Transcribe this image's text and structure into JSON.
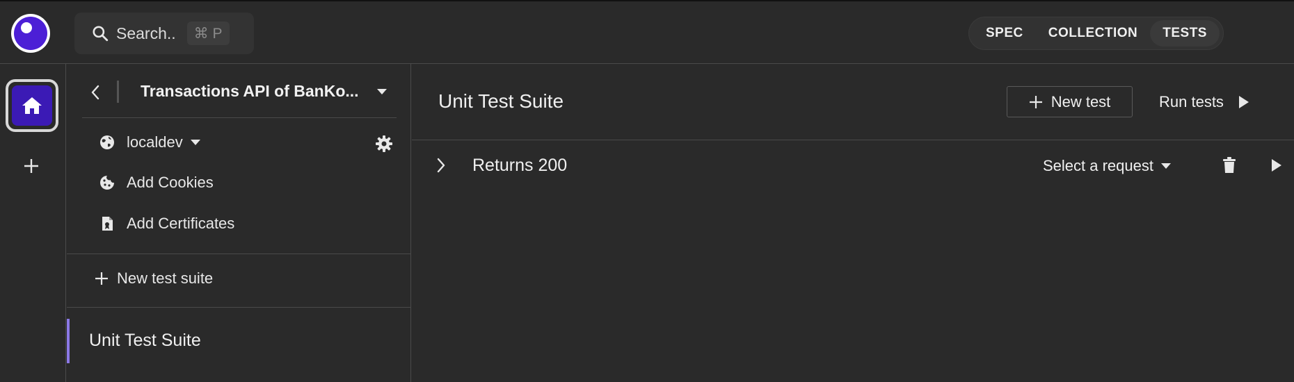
{
  "topbar": {
    "search_placeholder": "Search..",
    "search_shortcut": "⌘ P",
    "tabs": [
      {
        "label": "SPEC",
        "active": false
      },
      {
        "label": "COLLECTION",
        "active": false
      },
      {
        "label": "TESTS",
        "active": true
      }
    ]
  },
  "sidebar": {
    "project_title": "Transactions API of BanKo...",
    "environment": "localdev",
    "add_cookies": "Add Cookies",
    "add_certificates": "Add Certificates",
    "new_test_suite": "New test suite",
    "suites": [
      {
        "label": "Unit Test Suite",
        "selected": true
      }
    ]
  },
  "main": {
    "title": "Unit Test Suite",
    "new_test_label": "New test",
    "run_tests_label": "Run tests",
    "tests": [
      {
        "name": "Returns 200",
        "request": "Select a request"
      }
    ]
  },
  "colors": {
    "background": "#2a2a2a",
    "accent": "#4c1fd6",
    "selection_accent": "#8b78e6",
    "border": "#4a4a4a"
  },
  "icons": [
    "logo-icon",
    "search-icon",
    "home-icon",
    "plus-icon",
    "chevron-left-icon",
    "caret-down-icon",
    "globe-icon",
    "gear-icon",
    "cookie-icon",
    "certificate-icon",
    "chevron-right-icon",
    "trash-icon",
    "play-icon"
  ]
}
